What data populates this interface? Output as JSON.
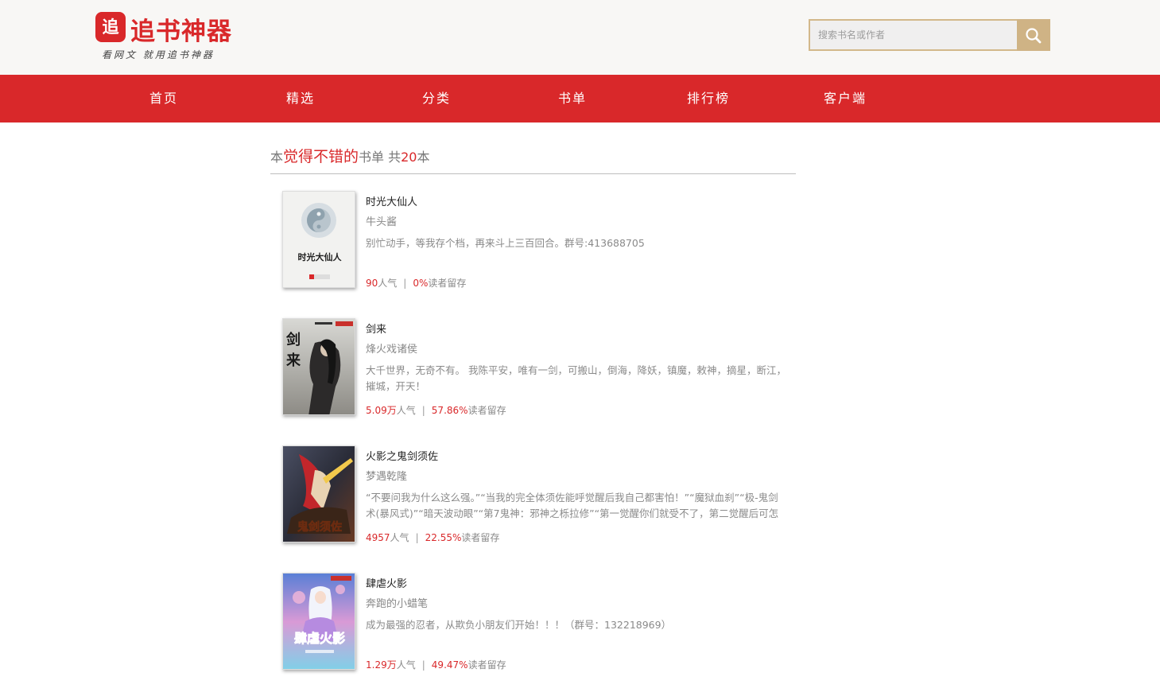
{
  "header": {
    "logo_char": "追",
    "logo_text": "追书神器",
    "slogan": "看网文 就用追书神器",
    "search_placeholder": "搜索书名或作者"
  },
  "nav": [
    {
      "label": "首页"
    },
    {
      "label": "精选"
    },
    {
      "label": "分类"
    },
    {
      "label": "书单"
    },
    {
      "label": "排行榜"
    },
    {
      "label": "客户端"
    }
  ],
  "list": {
    "prefix": "本",
    "title": "觉得不错的",
    "suffix": "书单 共",
    "count": "20",
    "unit": "本"
  },
  "books": [
    {
      "title": "时光大仙人",
      "author": "牛头酱",
      "desc": "别忙动手，等我存个档，再来斗上三百回合。群号:413688705",
      "popularity": "90",
      "popularity_unit": "人气",
      "retention": "0%",
      "retention_label": "读者留存",
      "cover_text": "时光大仙人"
    },
    {
      "title": "剑来",
      "author": "烽火戏诸侯",
      "desc": "大千世界，无奇不有。 我陈平安，唯有一剑，可搬山，倒海，降妖，镇魔，敕神，摘星，断江，摧城，开天！",
      "popularity": "5.09万",
      "popularity_unit": "人气",
      "retention": "57.86%",
      "retention_label": "读者留存",
      "cover_text": "剑来"
    },
    {
      "title": "火影之鬼剑须佐",
      "author": "梦遇乾隆",
      "desc": "“不要问我为什么这么强。”“当我的完全体须佐能呼觉醒后我自己都害怕！”“魔狱血刹”“极-鬼剑术(暴风式)”“暗天波动眼”“第7鬼神：邪神之栎拉修”“第一觉醒你们就受不了，第二觉醒后可怎么办呀。”穿...",
      "popularity": "4957",
      "popularity_unit": "人气",
      "retention": "22.55%",
      "retention_label": "读者留存",
      "cover_text": "鬼剑须佐"
    },
    {
      "title": "肆虐火影",
      "author": "奔跑的小蜡笔",
      "desc": "成为最强的忍者，从欺负小朋友们开始！！！（群号：132218969）",
      "popularity": "1.29万",
      "popularity_unit": "人气",
      "retention": "49.47%",
      "retention_label": "读者留存",
      "cover_text": "肆虐火影"
    }
  ],
  "colors": {
    "brand_red": "#d9282a",
    "search_gold": "#cfb385"
  }
}
